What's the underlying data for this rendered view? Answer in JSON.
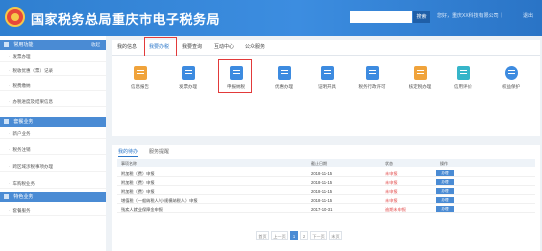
{
  "header": {
    "title": "国家税务总局重庆市电子税务局",
    "search_label": "搜索",
    "user_info": "您好，重庆XX科技有限公司｜",
    "logout": "退出"
  },
  "sidebar": {
    "sections": [
      {
        "title": "常用功能",
        "action": "收起",
        "items": [
          "发票办理",
          "税收优惠（票）记录",
          "税费缴纳",
          "办税进度及结果信息"
        ]
      },
      {
        "title": "套餐业务",
        "items": [
          "新户业务",
          "税务注销",
          "跨区域涉税事项办理",
          "车购税业务"
        ]
      },
      {
        "title": "特色业务",
        "items": [
          "套餐服务"
        ]
      }
    ]
  },
  "tabs": [
    "我的信息",
    "我要办税",
    "我要查询",
    "互动中心",
    "公众服务"
  ],
  "active_tab_index": 1,
  "func_icons": [
    {
      "label": "信息报告",
      "color": "#f0a33b",
      "icon": "document-icon"
    },
    {
      "label": "发票办理",
      "color": "#3d8be0",
      "icon": "invoice-icon"
    },
    {
      "label": "申报纳税",
      "color": "#3d8be0",
      "icon": "tax-declare-icon"
    },
    {
      "label": "优惠办理",
      "color": "#3d8be0",
      "icon": "discount-icon"
    },
    {
      "label": "证明开具",
      "color": "#3d8be0",
      "icon": "certificate-icon"
    },
    {
      "label": "税务行政许可",
      "color": "#3d8be0",
      "icon": "permit-icon"
    },
    {
      "label": "核定税办理",
      "color": "#f0a33b",
      "icon": "approve-icon"
    },
    {
      "label": "信用评价",
      "color": "#36b5c9",
      "icon": "credit-icon"
    },
    {
      "label": "权益保护",
      "color": "#3d8be0",
      "icon": "protect-icon"
    }
  ],
  "sub_tabs": [
    "我的待办",
    "服务提醒"
  ],
  "table": {
    "headers": [
      "事项名称",
      "截止日期",
      "状态",
      "操作"
    ],
    "rows": [
      {
        "name": "附加税（费）申报",
        "date": "2018-11-15",
        "status": "未申报",
        "action": "办理"
      },
      {
        "name": "附加税（费）申报",
        "date": "2018-11-15",
        "status": "未申报",
        "action": "办理"
      },
      {
        "name": "附加税（费）申报",
        "date": "2018-11-15",
        "status": "未申报",
        "action": "办理"
      },
      {
        "name": "增值税（一般纳税人/小规模纳税人）申报",
        "date": "2018-11-15",
        "status": "未申报",
        "action": "办理"
      },
      {
        "name": "残疾人就业保障金申报",
        "date": "2017-10-31",
        "status": "逾期未申报",
        "action": "办理"
      }
    ]
  },
  "pager": {
    "first": "首页",
    "prev": "上一页",
    "pages": [
      "1",
      "2"
    ],
    "current": "1",
    "next": "下一页",
    "last": "末页"
  }
}
